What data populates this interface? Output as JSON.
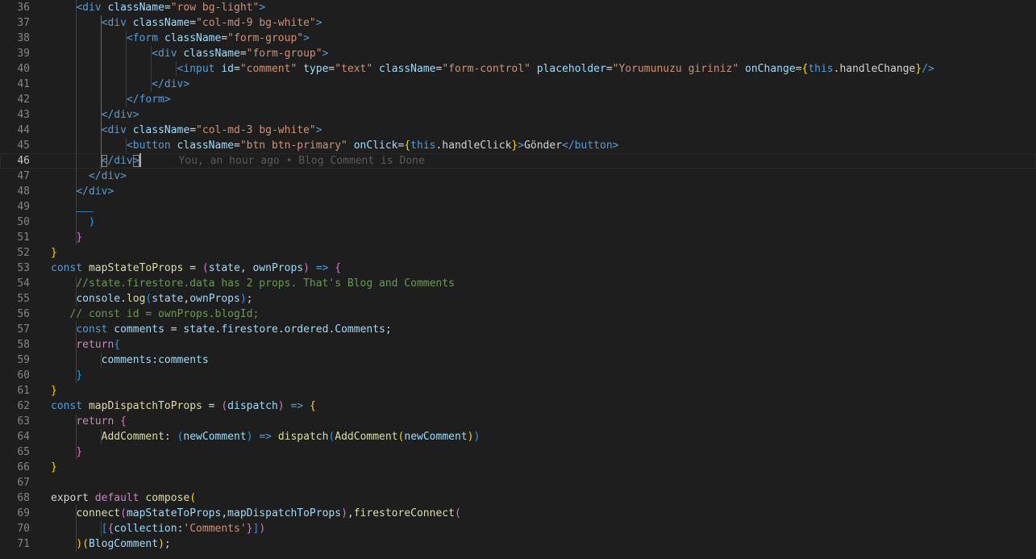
{
  "editor": {
    "current_line": "46",
    "blame_text": "You, an hour ago • Blog Comment is Done",
    "lines": [
      {
        "n": "36",
        "t": [
          [
            "    ",
            "txt"
          ],
          [
            "<div ",
            "tag"
          ],
          [
            "className",
            "attr"
          ],
          [
            "=",
            "txt"
          ],
          [
            "\"row bg-light\"",
            "str"
          ],
          [
            ">",
            "tag"
          ]
        ]
      },
      {
        "n": "37",
        "t": [
          [
            "        ",
            "txt"
          ],
          [
            "<div ",
            "tag"
          ],
          [
            "className",
            "attr"
          ],
          [
            "=",
            "txt"
          ],
          [
            "\"col-md-9 bg-white\"",
            "str"
          ],
          [
            ">",
            "tag"
          ]
        ]
      },
      {
        "n": "38",
        "t": [
          [
            "            ",
            "txt"
          ],
          [
            "<form ",
            "tag"
          ],
          [
            "className",
            "attr"
          ],
          [
            "=",
            "txt"
          ],
          [
            "\"form-group\"",
            "str"
          ],
          [
            ">",
            "tag"
          ]
        ]
      },
      {
        "n": "39",
        "t": [
          [
            "                ",
            "txt"
          ],
          [
            "<div ",
            "tag"
          ],
          [
            "className",
            "attr"
          ],
          [
            "=",
            "txt"
          ],
          [
            "\"form-group\"",
            "str"
          ],
          [
            ">",
            "tag"
          ]
        ]
      },
      {
        "n": "40",
        "t": [
          [
            "                    ",
            "txt"
          ],
          [
            "<input ",
            "tag"
          ],
          [
            "id",
            "attr"
          ],
          [
            "=",
            "txt"
          ],
          [
            "\"comment\"",
            "str"
          ],
          [
            " ",
            "txt"
          ],
          [
            "type",
            "attr"
          ],
          [
            "=",
            "txt"
          ],
          [
            "\"text\"",
            "str"
          ],
          [
            " ",
            "txt"
          ],
          [
            "className",
            "attr"
          ],
          [
            "=",
            "txt"
          ],
          [
            "\"form-control\"",
            "str"
          ],
          [
            " ",
            "txt"
          ],
          [
            "placeholder",
            "attr"
          ],
          [
            "=",
            "txt"
          ],
          [
            "\"Yorumunuzu giriniz\"",
            "str"
          ],
          [
            " ",
            "txt"
          ],
          [
            "onChange",
            "attr"
          ],
          [
            "=",
            "txt"
          ],
          [
            "{",
            "b1"
          ],
          [
            "this",
            "kw"
          ],
          [
            ".handleChange",
            "txt"
          ],
          [
            "}",
            "b1"
          ],
          [
            "/>",
            "tag"
          ]
        ]
      },
      {
        "n": "41",
        "t": [
          [
            "                ",
            "txt"
          ],
          [
            "</div>",
            "tag"
          ]
        ]
      },
      {
        "n": "42",
        "t": [
          [
            "            ",
            "txt"
          ],
          [
            "</form>",
            "tag"
          ]
        ]
      },
      {
        "n": "43",
        "t": [
          [
            "        ",
            "txt"
          ],
          [
            "</div>",
            "tag"
          ]
        ]
      },
      {
        "n": "44",
        "t": [
          [
            "        ",
            "txt"
          ],
          [
            "<div ",
            "tag"
          ],
          [
            "className",
            "attr"
          ],
          [
            "=",
            "txt"
          ],
          [
            "\"col-md-3 bg-white\"",
            "str"
          ],
          [
            ">",
            "tag"
          ]
        ]
      },
      {
        "n": "45",
        "t": [
          [
            "            ",
            "txt"
          ],
          [
            "<button ",
            "tag"
          ],
          [
            "className",
            "attr"
          ],
          [
            "=",
            "txt"
          ],
          [
            "\"btn btn-primary\"",
            "str"
          ],
          [
            " ",
            "txt"
          ],
          [
            "onClick",
            "attr"
          ],
          [
            "=",
            "txt"
          ],
          [
            "{",
            "b1"
          ],
          [
            "this",
            "kw"
          ],
          [
            ".handleClick",
            "txt"
          ],
          [
            "}",
            "b1"
          ],
          [
            ">",
            "tag"
          ],
          [
            "Gönder",
            "txt"
          ],
          [
            "</button>",
            "tag"
          ]
        ]
      },
      {
        "n": "46",
        "t": [
          [
            "        ",
            "txt"
          ],
          [
            "<",
            "match"
          ],
          [
            "/div",
            "tag"
          ],
          [
            ">",
            "match"
          ]
        ],
        "blame": true
      },
      {
        "n": "47",
        "t": [
          [
            "      ",
            "txt"
          ],
          [
            "</div>",
            "tag"
          ]
        ]
      },
      {
        "n": "48",
        "t": [
          [
            "    ",
            "txt"
          ],
          [
            "</div>",
            "tag"
          ]
        ]
      },
      {
        "n": "49",
        "t": []
      },
      {
        "n": "50",
        "t": [
          [
            "      ",
            "txt"
          ],
          [
            ")",
            "b3"
          ]
        ]
      },
      {
        "n": "51",
        "t": [
          [
            "    ",
            "txt"
          ],
          [
            "}",
            "b2"
          ]
        ]
      },
      {
        "n": "52",
        "t": [
          [
            "}",
            "b1"
          ]
        ]
      },
      {
        "n": "53",
        "t": [
          [
            "const ",
            "kw"
          ],
          [
            "mapStateToProps",
            "fn"
          ],
          [
            " = ",
            "txt"
          ],
          [
            "(",
            "b2"
          ],
          [
            "state",
            "var"
          ],
          [
            ", ",
            "txt"
          ],
          [
            "ownProps",
            "var"
          ],
          [
            ")",
            "b2"
          ],
          [
            " => ",
            "kw"
          ],
          [
            "{",
            "b2"
          ]
        ]
      },
      {
        "n": "54",
        "t": [
          [
            "    ",
            "txt"
          ],
          [
            "//state.firestore.data has 2 props. That's Blog and Comments",
            "com"
          ]
        ]
      },
      {
        "n": "55",
        "t": [
          [
            "    ",
            "txt"
          ],
          [
            "console",
            "var"
          ],
          [
            ".",
            "txt"
          ],
          [
            "log",
            "fn"
          ],
          [
            "(",
            "b3"
          ],
          [
            "state",
            "var"
          ],
          [
            ",",
            "txt"
          ],
          [
            "ownProps",
            "var"
          ],
          [
            ")",
            "b3"
          ],
          [
            ";",
            "txt"
          ]
        ]
      },
      {
        "n": "56",
        "t": [
          [
            "   ",
            "txt"
          ],
          [
            "// const id = ownProps.blogId;",
            "com"
          ]
        ]
      },
      {
        "n": "57",
        "t": [
          [
            "    ",
            "txt"
          ],
          [
            "const ",
            "kw"
          ],
          [
            "comments",
            "var"
          ],
          [
            " = ",
            "txt"
          ],
          [
            "state",
            "var"
          ],
          [
            ".",
            "txt"
          ],
          [
            "firestore",
            "var"
          ],
          [
            ".",
            "txt"
          ],
          [
            "ordered",
            "var"
          ],
          [
            ".",
            "txt"
          ],
          [
            "Comments",
            "var"
          ],
          [
            ";",
            "txt"
          ]
        ]
      },
      {
        "n": "58",
        "t": [
          [
            "    ",
            "txt"
          ],
          [
            "return",
            "ctl"
          ],
          [
            "{",
            "b3"
          ]
        ]
      },
      {
        "n": "59",
        "t": [
          [
            "        ",
            "txt"
          ],
          [
            "comments",
            "var"
          ],
          [
            ":",
            "txt"
          ],
          [
            "comments",
            "var"
          ]
        ]
      },
      {
        "n": "60",
        "t": [
          [
            "    ",
            "txt"
          ],
          [
            "}",
            "b3"
          ]
        ]
      },
      {
        "n": "61",
        "t": [
          [
            "}",
            "b1"
          ]
        ]
      },
      {
        "n": "62",
        "t": [
          [
            "const ",
            "kw"
          ],
          [
            "mapDispatchToProps",
            "fn"
          ],
          [
            " = ",
            "txt"
          ],
          [
            "(",
            "b2"
          ],
          [
            "dispatch",
            "var"
          ],
          [
            ")",
            "b2"
          ],
          [
            " => ",
            "kw"
          ],
          [
            "{",
            "b1"
          ]
        ]
      },
      {
        "n": "63",
        "t": [
          [
            "    ",
            "txt"
          ],
          [
            "return ",
            "ctl"
          ],
          [
            "{",
            "b2"
          ]
        ]
      },
      {
        "n": "64",
        "t": [
          [
            "        ",
            "txt"
          ],
          [
            "AddComment",
            "fn"
          ],
          [
            ": ",
            "txt"
          ],
          [
            "(",
            "b3"
          ],
          [
            "newComment",
            "var"
          ],
          [
            ")",
            "b3"
          ],
          [
            " => ",
            "kw"
          ],
          [
            "dispatch",
            "fn"
          ],
          [
            "(",
            "b3"
          ],
          [
            "AddComment",
            "fn"
          ],
          [
            "(",
            "b1"
          ],
          [
            "newComment",
            "var"
          ],
          [
            ")",
            "b1"
          ],
          [
            ")",
            "b3"
          ]
        ]
      },
      {
        "n": "65",
        "t": [
          [
            "    ",
            "txt"
          ],
          [
            "}",
            "b2"
          ]
        ]
      },
      {
        "n": "66",
        "t": [
          [
            "}",
            "b1"
          ]
        ]
      },
      {
        "n": "67",
        "t": []
      },
      {
        "n": "68",
        "t": [
          [
            "export ",
            "txt"
          ],
          [
            "default ",
            "ctl"
          ],
          [
            "compose",
            "fn"
          ],
          [
            "(",
            "b1"
          ]
        ]
      },
      {
        "n": "69",
        "t": [
          [
            "    ",
            "txt"
          ],
          [
            "connect",
            "fn"
          ],
          [
            "(",
            "b2"
          ],
          [
            "mapStateToProps",
            "var"
          ],
          [
            ",",
            "txt"
          ],
          [
            "mapDispatchToProps",
            "var"
          ],
          [
            ")",
            "b2"
          ],
          [
            ",",
            "txt"
          ],
          [
            "firestoreConnect",
            "fn"
          ],
          [
            "(",
            "b2"
          ]
        ]
      },
      {
        "n": "70",
        "t": [
          [
            "        ",
            "txt"
          ],
          [
            "[",
            "b3"
          ],
          [
            "{",
            "b2"
          ],
          [
            "collection",
            "var"
          ],
          [
            ":",
            "txt"
          ],
          [
            "'Comments'",
            "str"
          ],
          [
            "}",
            "b2"
          ],
          [
            "]",
            "b3"
          ],
          [
            ")",
            "b2"
          ]
        ]
      },
      {
        "n": "71",
        "t": [
          [
            "    ",
            "txt"
          ],
          [
            ")",
            "b1"
          ],
          [
            "(",
            "b1"
          ],
          [
            "BlogComment",
            "var"
          ],
          [
            ")",
            "b1"
          ],
          [
            ";",
            "txt"
          ]
        ]
      }
    ]
  }
}
